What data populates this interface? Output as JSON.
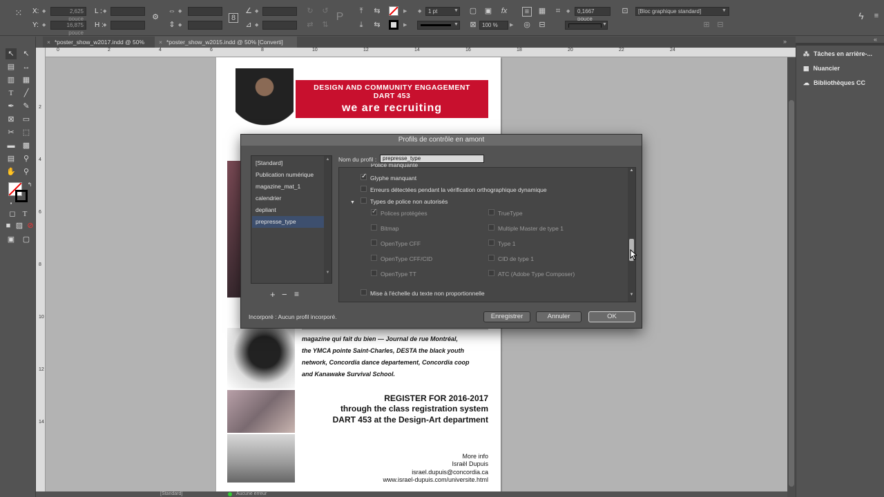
{
  "control_bar": {
    "x_label": "X:",
    "y_label": "Y:",
    "l_label": "L :",
    "h_label": "H :",
    "x_value": "2,625 pouce",
    "y_value": "16,875 pouce",
    "stroke_weight": "1 pt",
    "opacity": "100 %",
    "size_value": "0,1667 pouce",
    "object_style": "[Bloc graphique standard]"
  },
  "tabs": [
    {
      "label": "*poster_show_w2017.indd @ 50%"
    },
    {
      "label": "*poster_show_w2015.indd @ 50% [Converti]"
    }
  ],
  "ruler_top": [
    "0",
    "2",
    "4",
    "6",
    "8",
    "10",
    "12",
    "14",
    "16",
    "18",
    "20",
    "22",
    "24"
  ],
  "ruler_left": [
    "2",
    "4",
    "6",
    "8",
    "10",
    "12",
    "14"
  ],
  "poster": {
    "banner_line1": "DESIGN AND COMMUNITY ENGAGEMENT",
    "banner_line2": "DART 453",
    "banner_line3": "we are recruiting",
    "body_line1": "magazine qui fait du bien — Journal de rue Montréal,",
    "body_line2": "the YMCA pointe Saint-Charles, DESTA the black youth",
    "body_line3": "network, Concordia dance departement, Concordia coop",
    "body_line4": "and Kanawake Survival School.",
    "register_line1": "REGISTER FOR 2016-2017",
    "register_line2": "through the class registration system",
    "register_line3": "DART 453 at the Design-Art department",
    "info_line1": "More info",
    "info_line2": "Israël Dupuis",
    "info_line3": "israel.dupuis@concordia.ca",
    "info_line4": "www.israel-dupuis.com/universite.html"
  },
  "right_panel": {
    "items": [
      {
        "label": "Tâches en arrière-..."
      },
      {
        "label": "Nuancier"
      },
      {
        "label": "Bibliothèques CC"
      }
    ]
  },
  "dialog": {
    "title": "Profils de contrôle en amont",
    "profiles": [
      {
        "label": "[Standard]"
      },
      {
        "label": "Publication numérique"
      },
      {
        "label": "magazine_mat_1"
      },
      {
        "label": "calendrier"
      },
      {
        "label": "depliant"
      },
      {
        "label": "prepresse_type"
      }
    ],
    "selected_profile": "prepresse_type",
    "name_label": "Nom du profil :",
    "name_value": "prepresse_type",
    "tree": {
      "cut_item": "Police manquante",
      "glyph": "Glyphe manquant",
      "spell": "Erreurs détectées pendant la vérification orthographique dynamique",
      "font_types": "Types de police non autorisés",
      "left_types": [
        "Polices protégées",
        "Bitmap",
        "OpenType CFF",
        "OpenType CFF/CID",
        "OpenType TT"
      ],
      "right_types": [
        "TrueType",
        "Multiple Master de type 1",
        "Type 1",
        "CID de type 1",
        "ATC (Adobe Type Composer)"
      ],
      "scaling": "Mise à l'échelle du texte non proportionnelle"
    },
    "embedded_text": "Incorporé : Aucun profil incorporé.",
    "buttons": {
      "save": "Enregistrer",
      "cancel": "Annuler",
      "ok": "OK"
    }
  },
  "status_bar": {
    "profile": "[Standard]",
    "errors": "Aucune erreur"
  }
}
